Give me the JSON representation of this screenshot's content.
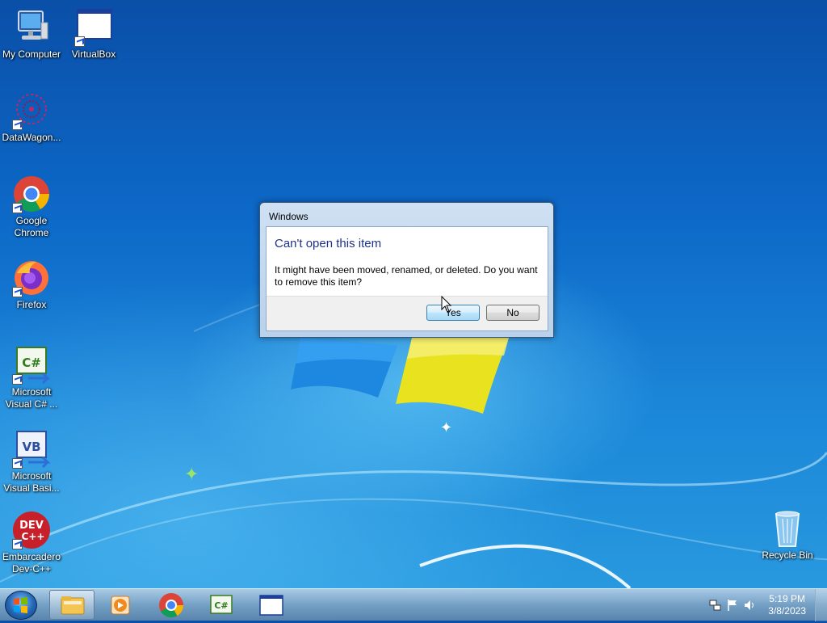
{
  "desktop_icons": [
    {
      "label": "My Computer",
      "icon": "computer-icon"
    },
    {
      "label": "VirtualBox",
      "icon": "virtualbox-icon"
    },
    {
      "label": "DataWagon...",
      "icon": "datawagon-icon"
    },
    {
      "label": "Google Chrome",
      "icon": "chrome-icon"
    },
    {
      "label": "Firefox",
      "icon": "firefox-icon"
    },
    {
      "label": "Microsoft Visual C# ...",
      "icon": "visual-csharp-icon"
    },
    {
      "label": "Microsoft Visual Basi...",
      "icon": "visual-basic-icon"
    },
    {
      "label": "Embarcadero Dev-C++",
      "icon": "devcpp-icon"
    },
    {
      "label": "Recycle Bin",
      "icon": "recycle-bin-icon"
    }
  ],
  "dialog": {
    "window_title": "Windows",
    "heading": "Can't open this item",
    "message": "It might have been moved, renamed, or deleted. Do you want to remove this item?",
    "yes_label": "Yes",
    "no_label": "No"
  },
  "taskbar": {
    "pinned": [
      {
        "name": "Windows Explorer",
        "icon": "explorer-icon"
      },
      {
        "name": "Windows Media Player",
        "icon": "media-player-icon"
      },
      {
        "name": "Google Chrome",
        "icon": "chrome-icon"
      },
      {
        "name": "Visual C#",
        "icon": "visual-csharp-icon"
      },
      {
        "name": "Window",
        "icon": "window-icon"
      }
    ],
    "clock": {
      "time": "5:19 PM",
      "date": "3/8/2023"
    }
  },
  "colors": {
    "accent": "#1e3287",
    "desktop": "#0d69c8"
  }
}
